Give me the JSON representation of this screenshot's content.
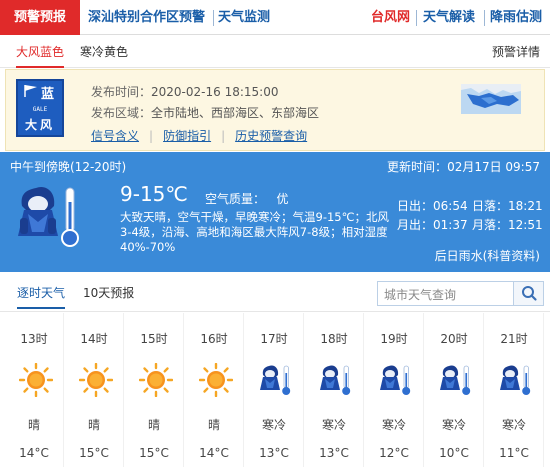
{
  "nav": {
    "alert": "预警预报",
    "items": [
      "深汕特别合作区预警",
      "天气监测",
      "台风网",
      "天气解读",
      "降雨估测"
    ]
  },
  "warning": {
    "tabs": [
      "大风蓝色",
      "寒冷黄色"
    ],
    "detail_link": "预警详情",
    "badge": {
      "level_char": "蓝",
      "en": "GALE",
      "name": "大风",
      "color": "#1e5dbf"
    },
    "publish_label": "发布时间：",
    "publish_time": "2020-02-16 18:15:00",
    "area_label": "发布区域：",
    "area": "全市陆地、西部海区、东部海区",
    "links": [
      "信号含义",
      "防御指引",
      "历史预警查询"
    ]
  },
  "forecast": {
    "period": "中午到傍晚(12-20时)",
    "update_label": "更新时间：",
    "update_time": "02月17日 09:57",
    "temp": "9-15℃",
    "aq_label": "空气质量：",
    "aq_value": "优",
    "desc": "大致天晴，空气干燥，早晚寒冷；气温9-15℃；北风3-4级，沿海、高地和海区最大阵风7-8级；相对湿度40%-70%",
    "sun": [
      {
        "label": "日出：",
        "value": "06:54",
        "label2": "日落：",
        "value2": "18:21"
      },
      {
        "label": "月出：",
        "value": "01:37",
        "label2": "月落：",
        "value2": "12:51"
      }
    ],
    "rain_link": "后日雨水(科普资料)",
    "bg_color": "#3a8ad8"
  },
  "forecast_tabs": [
    "逐时天气",
    "10天预报"
  ],
  "search": {
    "placeholder": "城市天气查询"
  },
  "hourly": [
    {
      "time": "13时",
      "icon": "sun-icon",
      "weather": "晴",
      "temp": "14°C"
    },
    {
      "time": "14时",
      "icon": "sun-icon",
      "weather": "晴",
      "temp": "15°C"
    },
    {
      "time": "15时",
      "icon": "sun-icon",
      "weather": "晴",
      "temp": "15°C"
    },
    {
      "time": "16时",
      "icon": "sun-icon",
      "weather": "晴",
      "temp": "14°C"
    },
    {
      "time": "17时",
      "icon": "cold-icon",
      "weather": "寒冷",
      "temp": "13°C"
    },
    {
      "time": "18时",
      "icon": "cold-icon",
      "weather": "寒冷",
      "temp": "13°C"
    },
    {
      "time": "19时",
      "icon": "cold-icon",
      "weather": "寒冷",
      "temp": "12°C"
    },
    {
      "time": "20时",
      "icon": "cold-icon",
      "weather": "寒冷",
      "temp": "10°C"
    },
    {
      "time": "21时",
      "icon": "cold-icon",
      "weather": "寒冷",
      "temp": "11°C"
    }
  ]
}
